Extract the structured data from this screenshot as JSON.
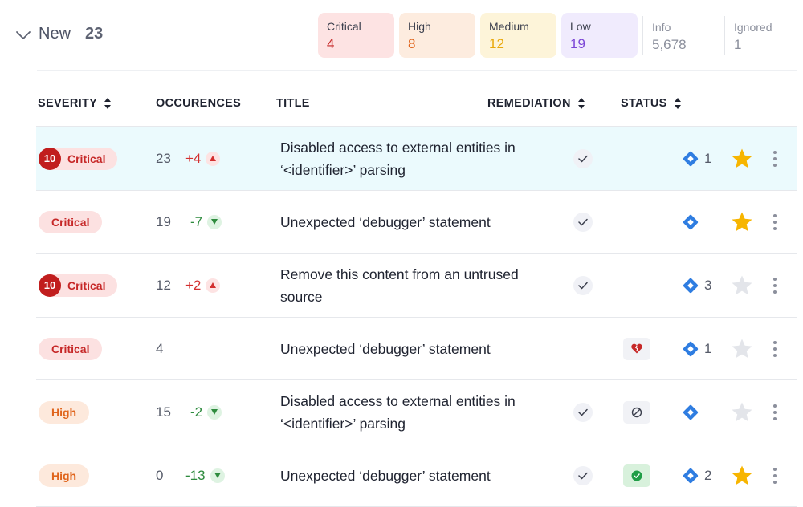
{
  "group": {
    "title": "New",
    "count": "23"
  },
  "summary": {
    "critical": {
      "label": "Critical",
      "count": "4"
    },
    "high": {
      "label": "High",
      "count": "8"
    },
    "medium": {
      "label": "Medium",
      "count": "12"
    },
    "low": {
      "label": "Low",
      "count": "19"
    },
    "info": {
      "label": "Info",
      "count": "5,678"
    },
    "ignored": {
      "label": "Ignored",
      "count": "1"
    }
  },
  "columns": {
    "severity": "SEVERITY",
    "occurrences": "OCCURENCES",
    "title": "TITLE",
    "remediation": "REMEDIATION",
    "status": "STATUS"
  },
  "colors": {
    "critical": "#c62828",
    "high": "#e0651d",
    "medium": "#e9a80b",
    "low": "#7b45d6",
    "increase": "#d32f2f",
    "decrease": "#2e8b3e",
    "jira_blue": "#2f7de1",
    "star_active": "#f7b500"
  },
  "rows": [
    {
      "severity": "Critical",
      "severity_level": "critical",
      "severity_number": "10",
      "occurrences": "23",
      "delta": "+4",
      "delta_direction": "up",
      "title": "Disabled access to external entities in ‘<identifier>’ parsing",
      "remediation_icon": "check-icon",
      "status_icon": "",
      "jira_count": "1",
      "starred": true,
      "selected": true
    },
    {
      "severity": "Critical",
      "severity_level": "critical",
      "severity_number": "",
      "occurrences": "19",
      "delta": "-7",
      "delta_direction": "down",
      "title": "Unexpected ‘debugger’ statement",
      "remediation_icon": "check-icon",
      "status_icon": "",
      "jira_count": "",
      "starred": true,
      "selected": false
    },
    {
      "severity": "Critical",
      "severity_level": "critical",
      "severity_number": "10",
      "occurrences": "12",
      "delta": "+2",
      "delta_direction": "up",
      "title": "Remove this content from an untrused source",
      "remediation_icon": "check-icon",
      "status_icon": "",
      "jira_count": "3",
      "starred": false,
      "selected": false
    },
    {
      "severity": "Critical",
      "severity_level": "critical",
      "severity_number": "",
      "occurrences": "4",
      "delta": "",
      "delta_direction": "",
      "title": "Unexpected ‘debugger’ statement",
      "remediation_icon": "",
      "status_icon": "broken-heart-icon",
      "jira_count": "1",
      "starred": false,
      "selected": false
    },
    {
      "severity": "High",
      "severity_level": "high",
      "severity_number": "",
      "occurrences": "15",
      "delta": "-2",
      "delta_direction": "down",
      "title": "Disabled access to external entities in ‘<identifier>’ parsing",
      "remediation_icon": "check-icon",
      "status_icon": "ignored-icon",
      "jira_count": "",
      "starred": false,
      "selected": false
    },
    {
      "severity": "High",
      "severity_level": "high",
      "severity_number": "",
      "occurrences": "0",
      "delta": "-13",
      "delta_direction": "down",
      "title": "Unexpected ‘debugger’ statement",
      "remediation_icon": "check-icon",
      "status_icon": "resolved-icon",
      "jira_count": "2",
      "starred": true,
      "selected": false
    }
  ]
}
